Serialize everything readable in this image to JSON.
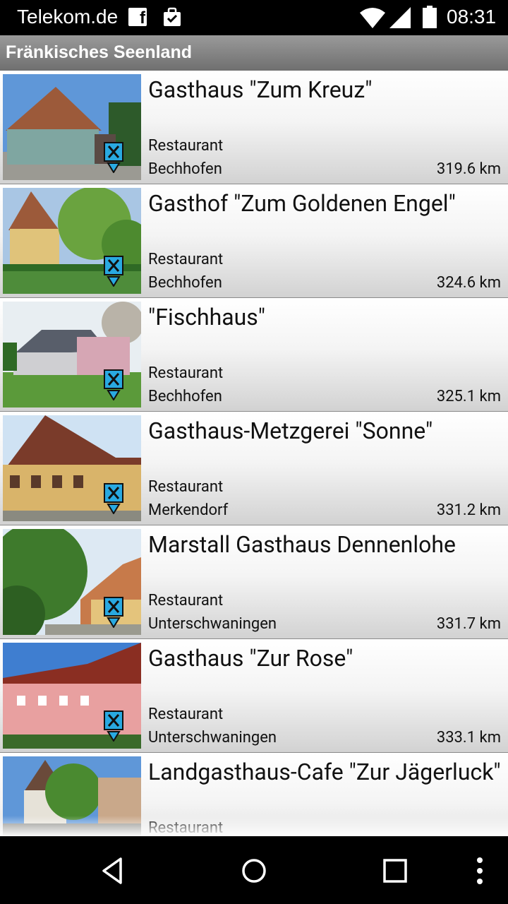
{
  "status_bar": {
    "carrier": "Telekom.de",
    "time": "08:31",
    "icons": [
      "facebook-icon",
      "shopping-bag-icon",
      "wifi-icon",
      "signal-icon",
      "battery-icon"
    ]
  },
  "header": {
    "title": "Fränkisches Seenland"
  },
  "list": {
    "items": [
      {
        "name": "Gasthaus \"Zum Kreuz\"",
        "type": "Restaurant",
        "place": "Bechhofen",
        "distance": "319.6 km"
      },
      {
        "name": "Gasthof \"Zum Goldenen Engel\"",
        "type": "Restaurant",
        "place": "Bechhofen",
        "distance": "324.6 km"
      },
      {
        "name": "\"Fischhaus\"",
        "type": "Restaurant",
        "place": "Bechhofen",
        "distance": "325.1 km"
      },
      {
        "name": "Gasthaus-Metzgerei \"Sonne\"",
        "type": "Restaurant",
        "place": "Merkendorf",
        "distance": "331.2 km"
      },
      {
        "name": "Marstall Gasthaus Dennenlohe",
        "type": "Restaurant",
        "place": "Unterschwaningen",
        "distance": "331.7 km"
      },
      {
        "name": "Gasthaus \"Zur Rose\"",
        "type": "Restaurant",
        "place": "Unterschwaningen",
        "distance": "333.1 km"
      },
      {
        "name": "Landgasthaus-Cafe \"Zur Jägerluck\"",
        "type": "Restaurant",
        "place": "",
        "distance": ""
      }
    ]
  },
  "nav_bar": {
    "icons": [
      "back-icon",
      "home-icon",
      "recents-icon",
      "overflow-menu-icon"
    ]
  },
  "colors": {
    "header_gradient_top": "#9a9a9a",
    "header_gradient_bottom": "#6f6f6f",
    "pin_blue": "#29a9e1"
  }
}
